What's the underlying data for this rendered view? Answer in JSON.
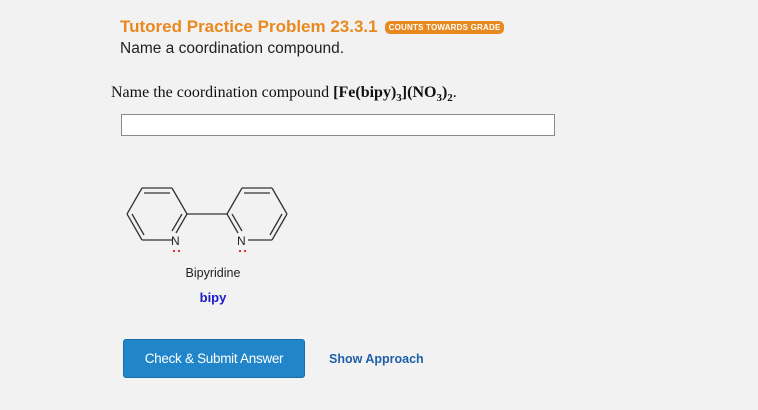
{
  "header": {
    "title": "Tutored Practice Problem 23.3.1",
    "badge": "COUNTS TOWARDS GRADE",
    "subtitle": "Name a coordination compound."
  },
  "question": {
    "prefix": "Name the coordination compound ",
    "formula_parts": [
      "[Fe(bipy)",
      "3",
      "](NO",
      "3",
      ")",
      "2"
    ],
    "suffix": "."
  },
  "answer": {
    "value": ""
  },
  "molecule": {
    "atom_label_1": "N",
    "atom_label_2": "N",
    "name": "Bipyridine",
    "abbreviation": "bipy",
    "lone_pair_color": "#e02020"
  },
  "actions": {
    "submit_label": "Check & Submit Answer",
    "approach_label": "Show Approach"
  },
  "colors": {
    "accent": "#e8891f",
    "button": "#2186c9",
    "link": "#1f5fa8",
    "abbreviation": "#1a1ac8"
  }
}
